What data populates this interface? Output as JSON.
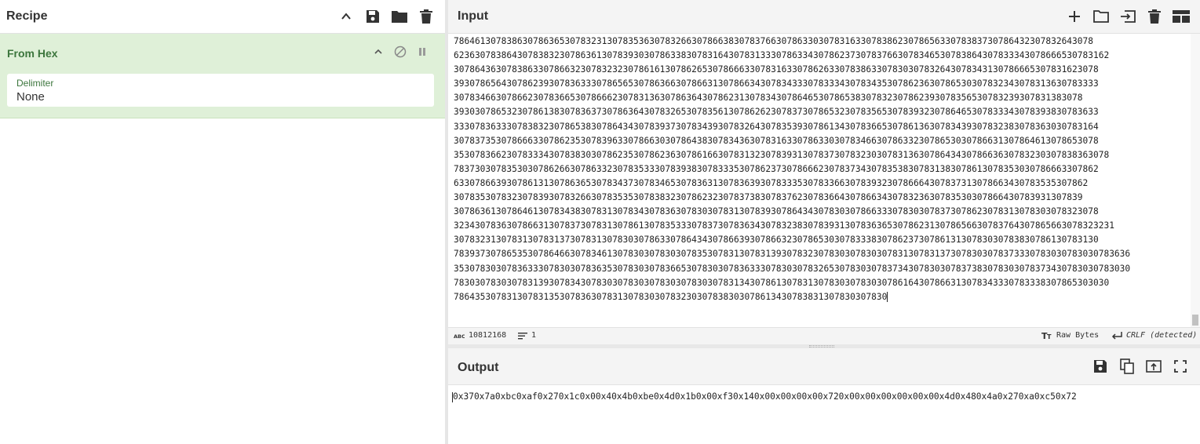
{
  "recipe": {
    "title": "Recipe",
    "operation": {
      "name": "From Hex",
      "arg_label": "Delimiter",
      "arg_value": "None"
    }
  },
  "input": {
    "title": "Input",
    "lines": [
      "786461307838630786365307832313078353630783266307866383078376630786330307831633078386230786563307838373078643230783264307​8",
      "6236307838643078383230786361307839303078633830783164307831333078633430786237307837663078346530783864307833343078666530783162",
      "3078643630783863307866323078323230786161307862653078666330783163307862633078386330783030783264307834313078666530783162307​8",
      "3930786564307862393078363330786565307863663078663130786634307834333078333430783435307862363078653030783234307831363078333​3",
      "3078346630786623078366530786662307831363078636430786231307834307864653078653830783230786239307835653078323930783138307​8",
      "3930307865323078613830783637307863643078326530783561307862623078373078653230783565307839323078646530783334307839383078363​3",
      "3330783633307838323078653830786434307839373078343930783264307835393078613430783665307861363078343930783238307836303078316​4",
      "3078373530786663307862353078396330786630307864383078343630783163307863303078346630786332307865303078663130786461307865307​8",
      "353078366230783334307838303078623530786236307861663078313230783931307837307832303078313630786434307866363078323030783836307​8",
      "7837303078353030786266307863323078353330783938307833353078623730786662307837343078353830783138307861307835303078666330786​2",
      "63307866393078613130786365307834373078346530783631307836393078333530783366307839323078666430783731307866343078353530786​2",
      "3078353078323078393078326630783535307838323078623230783738307837623078366430786634307832363078353030786643078393130783​9",
      "3078636130786461307834383078313078343078363078303078313078393078643430783030786633307830307837307862307831307830307832307​8",
      "3234307836307866313078373078313078613078353330783730783634307832383078393130783636530786231307865663078376430786566307832323​1",
      "3078323130783130783137307831307830307863307864343078663930786632307865303078333830786237307861313078303078383078613078313​0",
      "7839373078653530786466307834613078303078303078353078313078313930783230783030783030783130783137307830307837333078303078303078363​6",
      "3530783030783633307830307836353078303078366530783030783633307830307832653078303078373430783030783738307830307837343078303078303​0",
      "783030783030783139307834307830307830307830307830307831343078613078313078303078303078616430786631307834333078333830786530303​0",
      "78643530783130783135307836307831307830307832303078383030786134307838313078303078​30"
    ],
    "status": {
      "length": "10812168",
      "lines": "1",
      "charset": "Raw Bytes",
      "eol": "CRLF (detected)"
    }
  },
  "output": {
    "title": "Output",
    "text": "0x370x7a0xbc0xaf0x270x1c0x00x40x4b0xbe0x4d0x1b0x00xf30x140x00x00x00x00x720x00x00x00x00x00x00x4d0x480x4a0x270xa0xc50x72"
  },
  "colors": {
    "accent_green": "#3c763d",
    "operation_bg": "#dff0d8"
  }
}
